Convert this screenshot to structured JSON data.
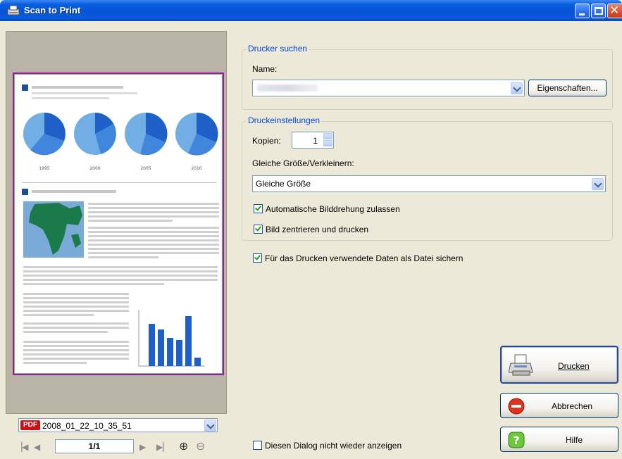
{
  "window": {
    "title": "Scan to Print"
  },
  "preview": {
    "file_name": "2008_01_22_10_35_51",
    "file_type_badge": "PDF",
    "page_indicator": "1/1",
    "doc_years": [
      "1995",
      "2000",
      "2005",
      "2010"
    ]
  },
  "printer_search": {
    "legend": "Drucker suchen",
    "name_label": "Name:",
    "name_value": "",
    "properties_button": "Eigenschaften..."
  },
  "print_settings": {
    "legend": "Druckeinstellungen",
    "copies_label": "Kopien:",
    "copies_value": "1",
    "scale_label": "Gleiche Größe/Verkleinern:",
    "scale_value": "Gleiche Größe",
    "auto_rotate_label": "Automatische Bilddrehung zulassen",
    "auto_rotate_checked": true,
    "center_label": "Bild zentrieren und drucken",
    "center_checked": true
  },
  "save_data": {
    "label": "Für das Drucken verwendete Daten als Datei sichern",
    "checked": true
  },
  "dont_show": {
    "label": "Diesen Dialog nicht wieder anzeigen",
    "checked": false
  },
  "buttons": {
    "print": "Drucken",
    "cancel": "Abbrechen",
    "help": "Hilfe"
  },
  "colors": {
    "accent": "#0046d5",
    "chart_blue": "#1f5fc8"
  }
}
